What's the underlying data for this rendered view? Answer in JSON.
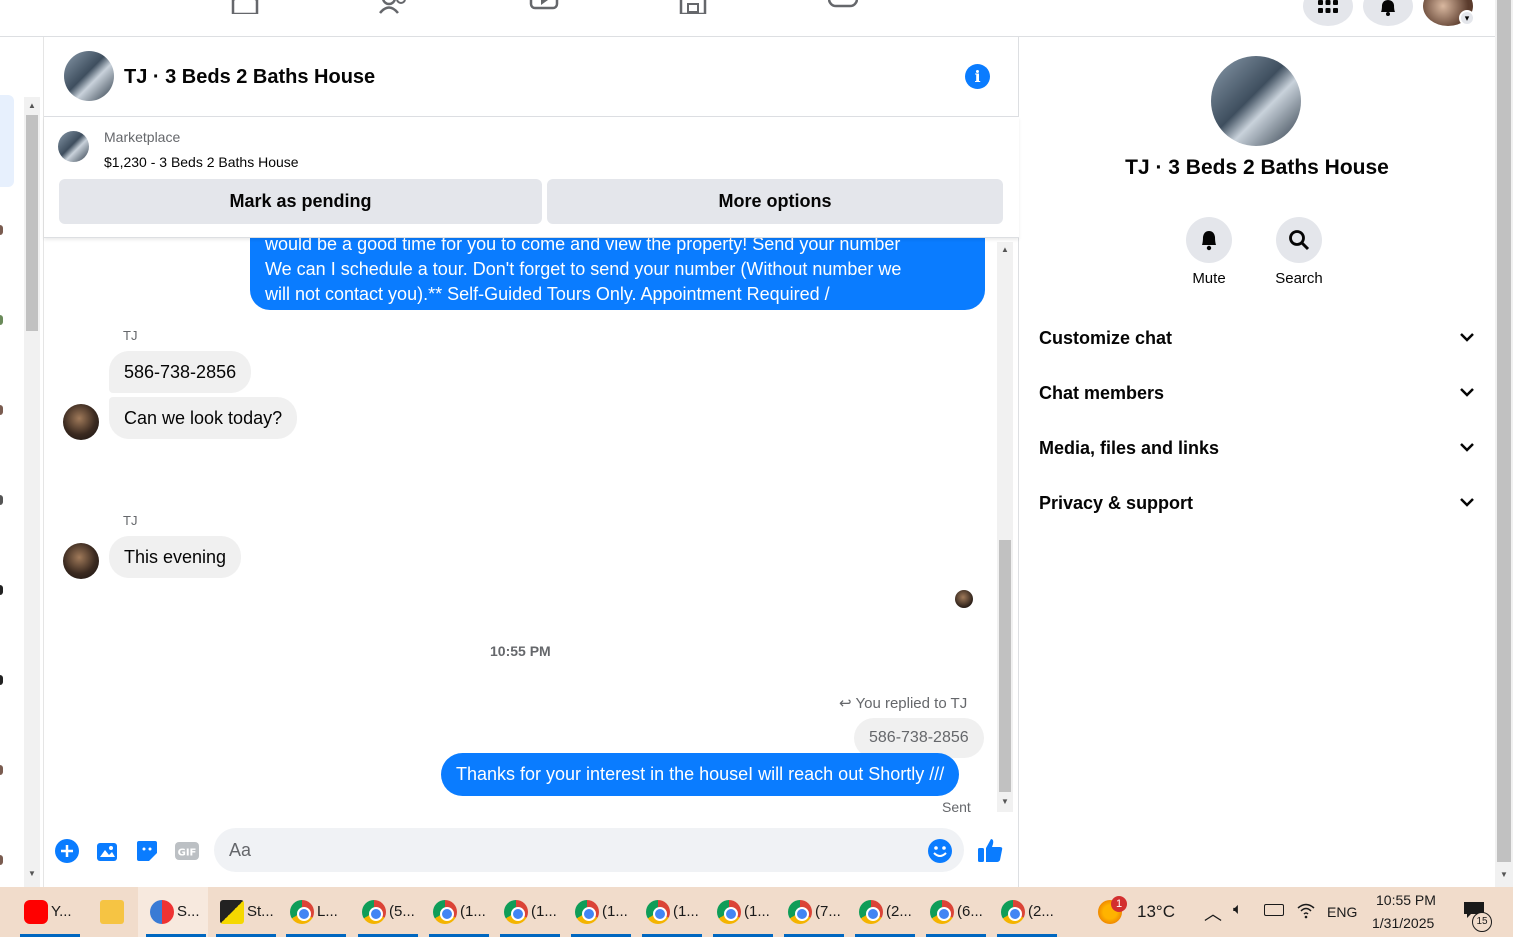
{
  "chat": {
    "title": "TJ · 3 Beds 2 Baths House",
    "marketplace": {
      "label": "Marketplace",
      "item": "$1,230 - 3 Beds 2 Baths House",
      "pending_button": "Mark as pending",
      "options_button": "More options"
    },
    "messages": {
      "outgoing_1_line1": "would be a good time for you to come and view the property! Send your number",
      "outgoing_1_line2": "We can I schedule a tour.  Don't forget to send your number (Without number we",
      "outgoing_1_line3": "will not contact you).** Self-Guided Tours Only. Appointment Required /",
      "sender_1": "TJ",
      "incoming_1": "586-738-2856",
      "incoming_2": "Can we look today?",
      "sender_2": "TJ",
      "incoming_3": "This evening",
      "time_divider": "10:55 PM",
      "replied_label": "You replied to TJ",
      "quoted": "586-738-2856",
      "outgoing_2": "Thanks for your interest in the houseI will reach out Shortly ///",
      "status": "Sent"
    },
    "composer_placeholder": "Aa"
  },
  "details": {
    "title": "TJ · 3 Beds 2 Baths House",
    "mute_label": "Mute",
    "search_label": "Search",
    "sections": [
      "Customize chat",
      "Chat members",
      "Media, files and links",
      "Privacy & support"
    ]
  },
  "taskbar": {
    "items": [
      "Y...",
      "",
      "S...",
      "St...",
      "L...",
      "(5...",
      "(1...",
      "(1...",
      "(1...",
      "(1...",
      "(1...",
      "(7...",
      "(2...",
      "(6...",
      "(2..."
    ],
    "weather_badge": "1",
    "temperature": "13°C",
    "language": "ENG",
    "time": "10:55 PM",
    "date": "1/31/2025",
    "notification_count": "15"
  },
  "colors": {
    "messenger_blue": "#0a7cff",
    "incoming_bubble": "#f0f0f0",
    "taskbar": "#f1dccb"
  }
}
